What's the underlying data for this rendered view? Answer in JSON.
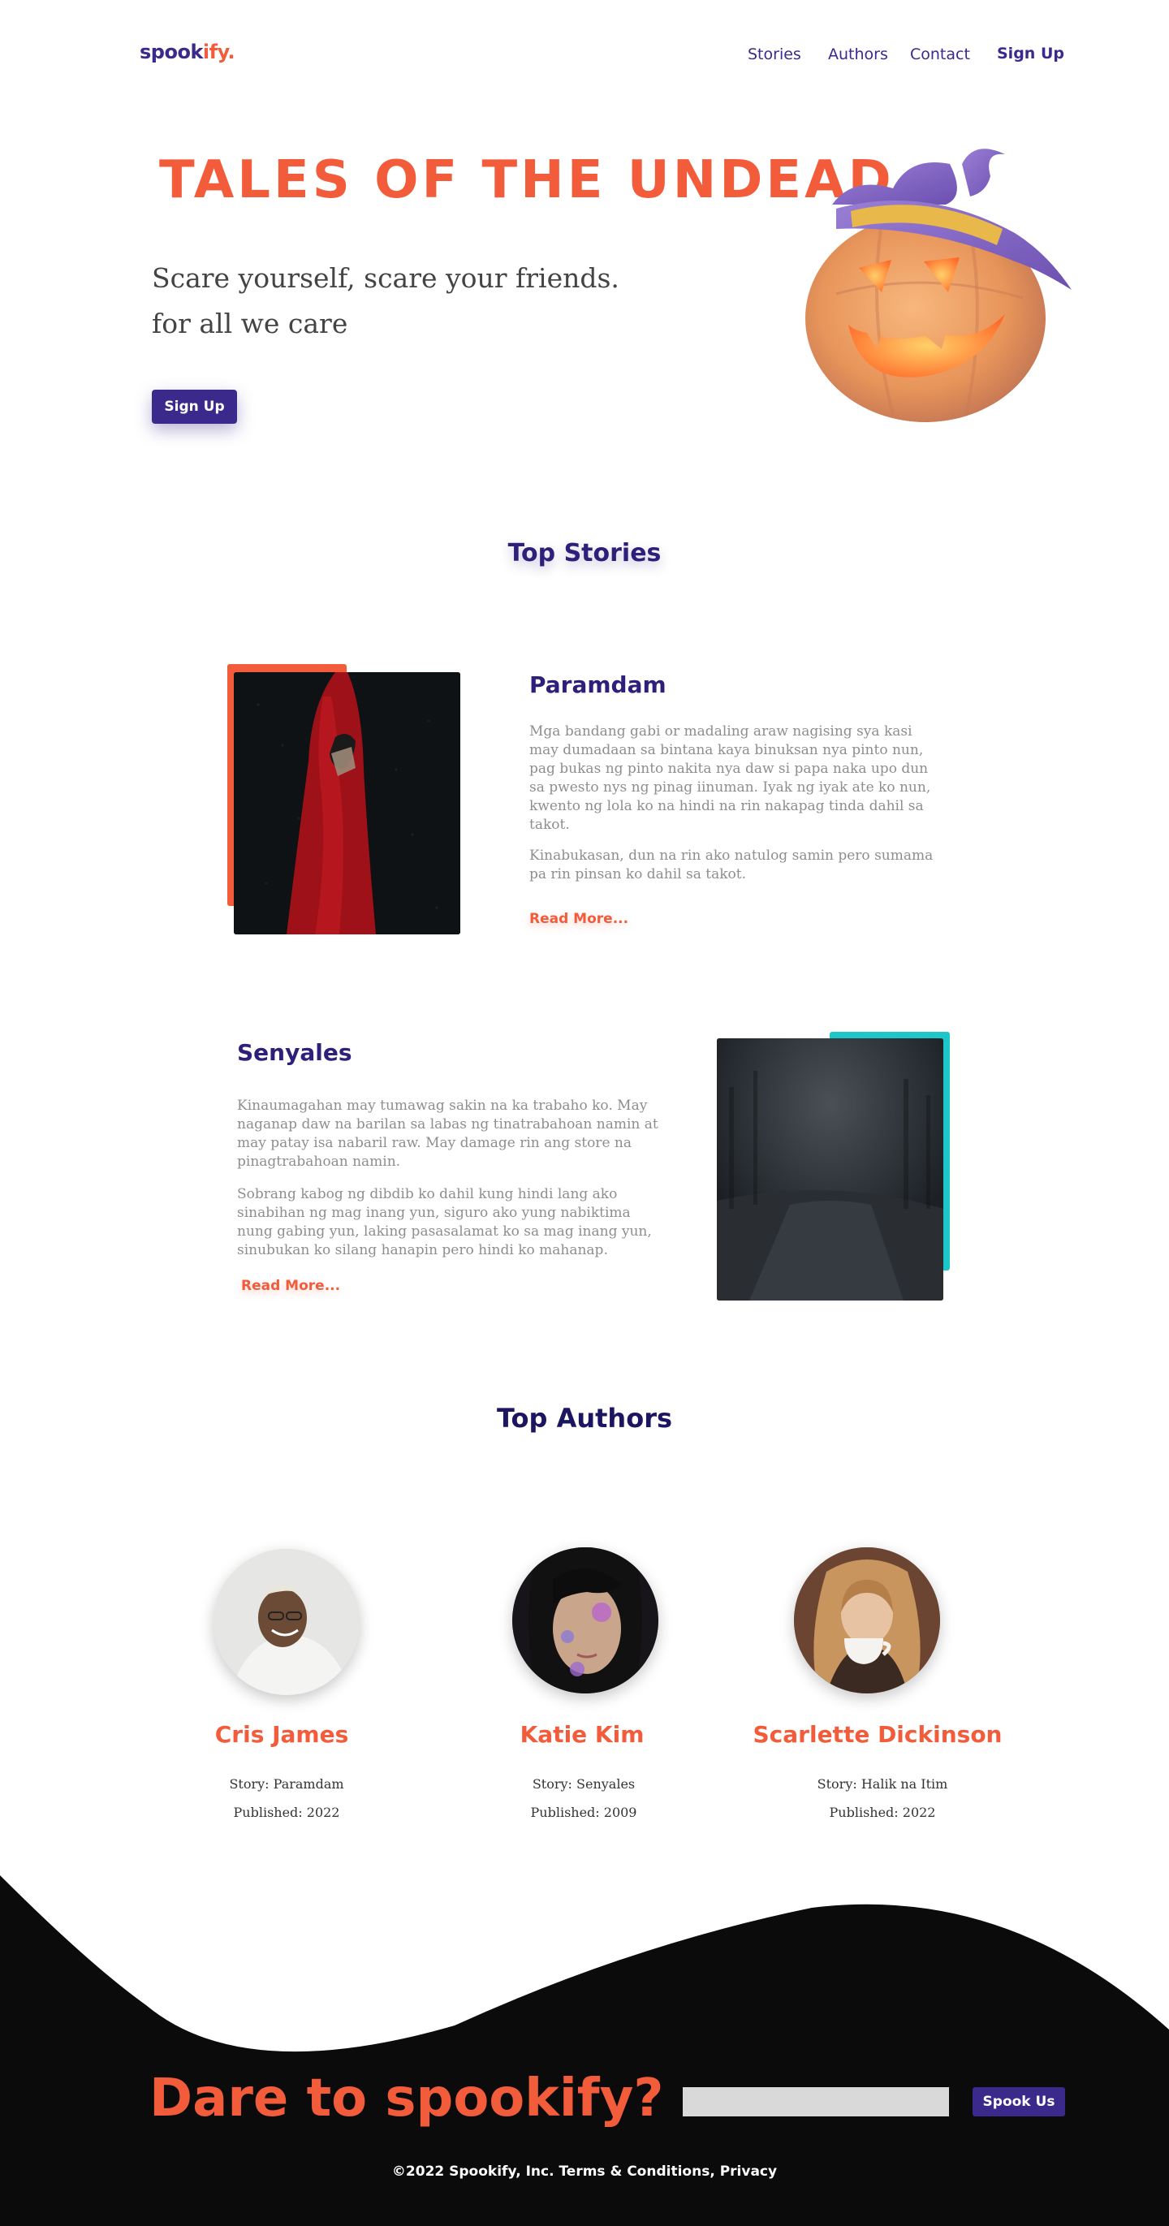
{
  "nav": {
    "logo_main": "spook",
    "logo_accent": "ify.",
    "links": [
      "Stories",
      "Authors",
      "Contact"
    ],
    "signup": "Sign Up"
  },
  "hero": {
    "title": "TALES OF THE UNDEAD",
    "line1": "Scare yourself, scare your friends.",
    "line2": "for all we care",
    "cta": "Sign Up",
    "image": "pumpkin-witch-hat"
  },
  "top_stories": {
    "heading": "Top Stories",
    "items": [
      {
        "title": "Paramdam",
        "p1": "Mga bandang gabi or madaling araw nagising sya kasi may dumadaan sa bintana kaya binuksan nya pinto nun, pag bukas ng pinto nakita nya daw si papa naka upo dun sa pwesto nys ng pinag iinuman. Iyak ng iyak ate ko nun, kwento ng lola ko na hindi na rin nakapag tinda dahil sa takot.",
        "p2": "Kinabukasan, dun na rin ako natulog samin pero sumama pa rin pinsan ko dahil sa takot.",
        "read_more": "Read More...",
        "accent": "#f25c3b"
      },
      {
        "title": "Senyales",
        "p1": "Kinaumagahan may tumawag sakin na ka trabaho ko. May naganap daw na barilan sa labas ng tinatrabahoan namin at may patay isa nabaril raw. May damage rin ang store na pinagtrabahoan namin.",
        "p2": "Sobrang kabog ng dibdib ko dahil kung hindi lang ako sinabihan ng mag inang yun, siguro ako yung nabiktima nung gabing yun, laking pasasalamat ko sa mag inang yun, sinubukan ko silang hanapin pero hindi ko mahanap.",
        "read_more": "Read More...",
        "accent": "#1fc6c9"
      }
    ]
  },
  "top_authors": {
    "heading": "Top Authors",
    "items": [
      {
        "name": "Cris James",
        "story": "Story: Paramdam",
        "published": "Published: 2022"
      },
      {
        "name": "Katie Kim",
        "story": "Story: Senyales",
        "published": "Published: 2009"
      },
      {
        "name": "Scarlette Dickinson",
        "story": "Story: Halik na Itim",
        "published": "Published: 2022"
      }
    ]
  },
  "footer": {
    "title": "Dare to spookify?",
    "email_placeholder": "",
    "button": "Spook Us",
    "copyright": "©2022  Spookify, Inc. Terms & Conditions, Privacy"
  },
  "colors": {
    "primary": "#3b2a8c",
    "accent": "#f25c3b",
    "teal": "#1fc6c9",
    "footer_bg": "#0b0b0b"
  }
}
